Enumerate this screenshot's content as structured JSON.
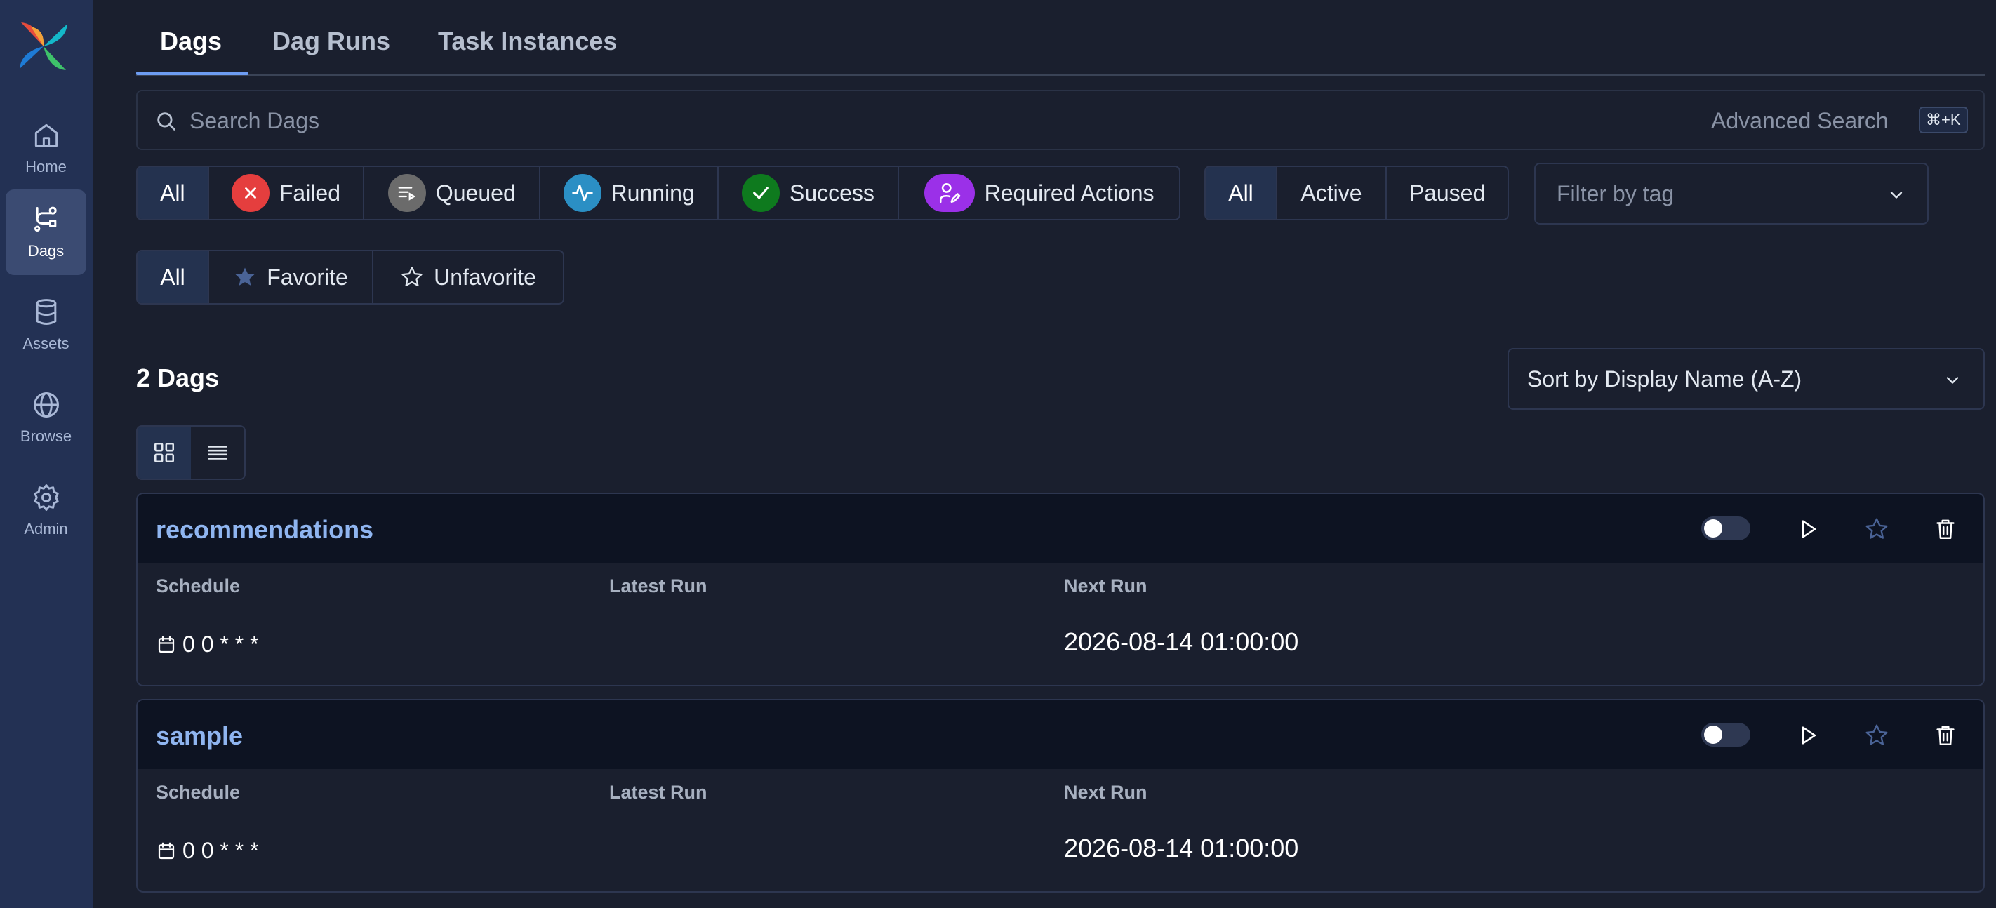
{
  "sidebar": {
    "items": [
      {
        "label": "Home",
        "icon": "home-icon"
      },
      {
        "label": "Dags",
        "icon": "dags-icon",
        "active": true
      },
      {
        "label": "Assets",
        "icon": "database-icon"
      },
      {
        "label": "Browse",
        "icon": "globe-icon"
      },
      {
        "label": "Admin",
        "icon": "gear-icon"
      }
    ]
  },
  "tabs": [
    {
      "label": "Dags",
      "active": true
    },
    {
      "label": "Dag Runs"
    },
    {
      "label": "Task Instances"
    }
  ],
  "search": {
    "placeholder": "Search Dags",
    "advanced_label": "Advanced Search",
    "shortcut": "⌘+K"
  },
  "state_filters": {
    "all": "All",
    "failed": "Failed",
    "queued": "Queued",
    "running": "Running",
    "success": "Success",
    "required_actions": "Required Actions"
  },
  "paused_filters": {
    "all": "All",
    "active": "Active",
    "paused": "Paused"
  },
  "tag_filter": {
    "placeholder": "Filter by tag"
  },
  "favorite_filters": {
    "all": "All",
    "favorite": "Favorite",
    "unfavorite": "Unfavorite"
  },
  "count_label": "2 Dags",
  "sort": {
    "label": "Sort by Display Name (A-Z)"
  },
  "columns": {
    "schedule": "Schedule",
    "latest_run": "Latest Run",
    "next_run": "Next Run"
  },
  "dags": [
    {
      "name": "recommendations",
      "schedule": "0 0 * * *",
      "latest_run": "",
      "next_run": "2026-08-14 01:00:00",
      "enabled": false
    },
    {
      "name": "sample",
      "schedule": "0 0 * * *",
      "latest_run": "",
      "next_run": "2026-08-14 01:00:00",
      "enabled": false
    }
  ],
  "colors": {
    "sidebar": "#233154",
    "background": "#1a1f2e",
    "accent": "#6d9cf2",
    "failed": "#e53e3e",
    "queued": "#6b6b6b",
    "running": "#2b8fc4",
    "success": "#0e7a1e",
    "required_actions": "#9b30e8"
  }
}
